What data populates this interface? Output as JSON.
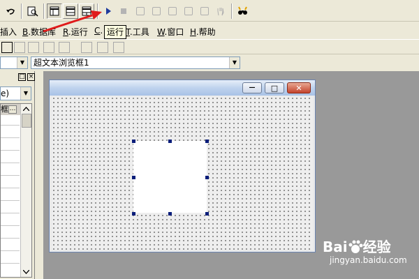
{
  "menu": {
    "items": [
      {
        "key": "",
        "label": "插入"
      },
      {
        "key": "B",
        "label": ".数据库"
      },
      {
        "key": "R",
        "label": ".运行"
      },
      {
        "key": "C",
        "label": "."
      },
      {
        "key": "T",
        "label": ".工具"
      },
      {
        "key": "W",
        "label": ".窗口"
      },
      {
        "key": "H",
        "label": ".帮助"
      }
    ]
  },
  "tooltip": {
    "text": "运行"
  },
  "component_combo": {
    "value": "超文本浏览框1",
    "arrow": "▼"
  },
  "left_panel": {
    "header_buttons": [
      "□",
      "×"
    ],
    "combo_value": "e)",
    "combo_arrow": "▼",
    "grid_cell": "框1",
    "ellipsis": "…"
  },
  "form": {
    "minimize_glyph": "—",
    "maximize_glyph": "□",
    "close_glyph": "✕"
  },
  "watermark": {
    "brand": "Bai",
    "brand_cn": "经验",
    "url": "jingyan.baidu.com"
  },
  "colors": {
    "arrow": "#e01b1b",
    "run_icon": "#1f3b9e",
    "handle": "#0a1e7a",
    "title_bar": "#bfd3ee"
  }
}
